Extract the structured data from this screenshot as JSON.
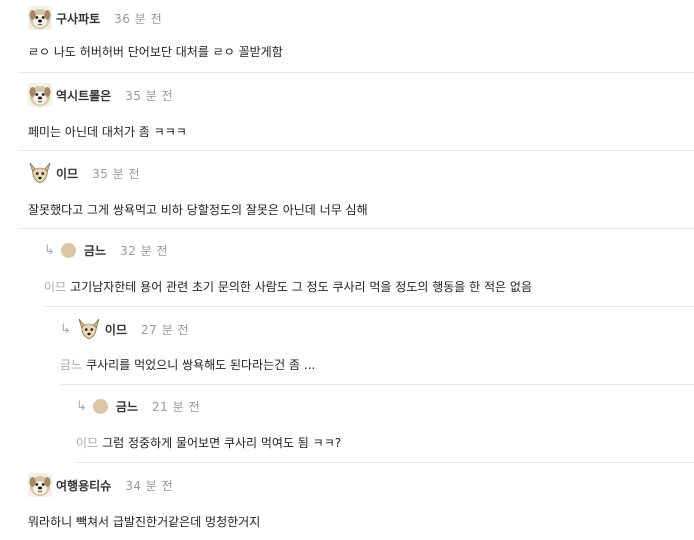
{
  "comments": [
    {
      "author": "구사파토",
      "time": "36 분 전",
      "text": "ㄹㅇ 나도 허버허버 단어보단 대처를 ㄹㅇ 꼴받게함"
    },
    {
      "author": "역시트롤은",
      "time": "35 분 전",
      "text": "페미는 아닌데 대처가 좀 ㅋㅋㅋ"
    },
    {
      "author": "이므",
      "time": "35 분 전",
      "text": "잘못했다고 그게 쌍욕먹고 비하 당할정도의 잘못은 아닌데 너무 심해"
    },
    {
      "author": "금느",
      "time": "32 분 전",
      "mention": "이므",
      "text": "고기남자한테 용어 관련 초기 문의한 사람도 그 정도 쿠사리 먹을 정도의 행동을 한 적은 없음"
    },
    {
      "author": "이므",
      "time": "27 분 전",
      "mention": "금느",
      "text": "쿠사리를 먹었으니 쌍욕해도 된다라는건 좀 ..."
    },
    {
      "author": "금느",
      "time": "21 분 전",
      "mention": "이므",
      "text": "그럼 정중하게 물어보면 쿠사리 먹여도 됨 ㅋㅋ?"
    },
    {
      "author": "여행용티슈",
      "time": "34 분 전",
      "text": "뭐라하니 빽쳐서 급발진한거같은데 멍청한거지"
    }
  ],
  "icons": {
    "reply": "reply-arrow-icon",
    "avatar_dog": "dog-avatar-icon",
    "avatar_chihuahua": "chihuahua-avatar-icon",
    "avatar_default": "default-avatar-dot"
  },
  "colors": {
    "author": "#333333",
    "time": "#999999",
    "mention": "#aaaaaa",
    "divider": "#e9e9e9",
    "default_avatar": "#d9c7a6"
  }
}
